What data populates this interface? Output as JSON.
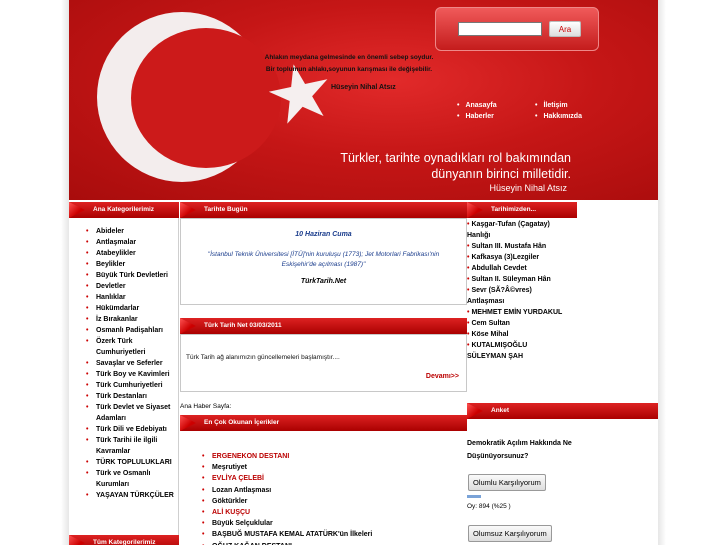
{
  "header": {
    "quote_line1": "Ahlakın meydana gelmesinde en önemli sebep soydur.",
    "quote_line2": "Bir toplumun ahlakı,soyunun karışması ile değişebilir.",
    "quote_author": "Hüseyin Nihal Atsız",
    "slogan_line1": "Türkler, tarihte oynadıkları rol bakımından",
    "slogan_line2": "dünyanın birinci milletidir.",
    "slogan_author": "Hüseyin Nihal Atsız",
    "search": {
      "value": "",
      "placeholder": "",
      "button_label": "Ara"
    },
    "nav": [
      {
        "label": "Anasayfa"
      },
      {
        "label": "İletişim"
      },
      {
        "label": "Haberler"
      },
      {
        "label": "Hakkımızda"
      }
    ]
  },
  "left": {
    "title": "Ana Kategorilerimiz",
    "items": [
      "Abideler",
      "Antlaşmalar",
      "Atabeylikler",
      "Beylikler",
      "Büyük Türk Devletleri",
      "Devletler",
      "Hanlıklar",
      "Hükümdarlar",
      "İz Bırakanlar",
      "Osmanlı Padişahları",
      "Özerk Türk Cumhuriyetleri",
      "Savaşlar ve Seferler",
      "Türk Boy ve Kavimleri",
      "Türk Cumhuriyetleri",
      "Türk Destanları",
      "Türk Devlet ve Siyaset Adamları",
      "Türk Dili ve Edebiyatı",
      "Türk Tarihi ile ilgili Kavramlar",
      "TÜRK TOPLULUKLARI",
      "Türk ve Osmanlı Kurumları",
      "YAŞAYAN TÜRKÇÜLER"
    ],
    "bottom_title": "Tüm Kategorilerimiz"
  },
  "middle": {
    "today_title": "Tarihte Bugün",
    "today_date": "10 Haziran Cuma",
    "today_event": "\"İstanbul Teknik Üniversitesi [İTÜ]'nin kuruluşu (1773); Jet Motorlari Fabrikası'nin Eskişehir'de açılması (1987)\"",
    "today_site": "TürkTarih.Net",
    "news_title": "Türk Tarih Net 03/03/2011",
    "news_text": "Türk Tarih ağ alanımızın güncellemeleri başlamıştır....",
    "news_more": "Devamı>>",
    "main_page_label": "Ana Haber Sayfa:",
    "popular_title": "En Çok Okunan İçerikler",
    "popular": [
      {
        "label": "ERGENEKON DESTANI",
        "red": true
      },
      {
        "label": "Meşrutiyet",
        "red": false
      },
      {
        "label": "EVLİYA ÇELEBİ",
        "red": true
      },
      {
        "label": "Lozan Antlaşması",
        "red": false
      },
      {
        "label": "Göktürkler",
        "red": false
      },
      {
        "label": "ALİ KUŞÇU",
        "red": true
      },
      {
        "label": "Büyük Selçuklular",
        "red": false
      },
      {
        "label": "BAŞBUĞ MUSTAFA KEMAL ATATÜRK'ün İlkeleri",
        "red": false
      },
      {
        "label": "OĞUZ KAĞAN DESTANI",
        "red": false
      }
    ]
  },
  "right": {
    "history_title": "Tarihimizden...",
    "history": [
      {
        "label": "Kaşgar-Tufan (Çagatay)",
        "bullet": true
      },
      {
        "label": "Hanlığı",
        "bullet": false
      },
      {
        "label": "Sultan III. Mustafa Hân",
        "bullet": true
      },
      {
        "label": "Kafkasya (3)Lezgiler",
        "bullet": true
      },
      {
        "label": "Abdullah Cevdet",
        "bullet": true
      },
      {
        "label": "Sultan II. Süleyman Hân",
        "bullet": true
      },
      {
        "label": "Sevr (SÃ?Â©vres)",
        "bullet": true
      },
      {
        "label": "Antlaşması",
        "bullet": false
      },
      {
        "label": "MEHMET EMİN YURDAKUL",
        "bullet": true
      },
      {
        "label": "Cem Sultan",
        "bullet": true
      },
      {
        "label": "Köse Mihal",
        "bullet": true
      },
      {
        "label": "KUTALMIŞOĞLU",
        "bullet": true
      },
      {
        "label": "SÜLEYMAN ŞAH",
        "bullet": false
      }
    ],
    "poll_title": "Anket",
    "poll_question": "Demokratik Açılım Hakkında Ne Düşünüyorsunuz?",
    "poll_option1": "Olumlu Karşılıyorum",
    "poll_result": "Oy: 894 (%25 )",
    "poll_percent": 25,
    "poll_option2": "Olumsuz Karşılıyorum"
  }
}
